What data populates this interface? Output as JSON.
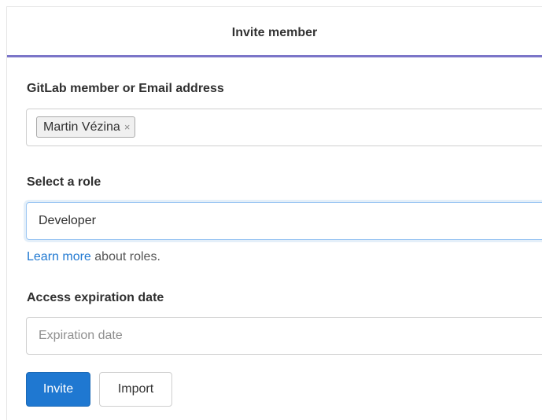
{
  "header": {
    "title": "Invite member"
  },
  "member_field": {
    "label": "GitLab member or Email address",
    "token_value": "Martin Vézina",
    "token_remove_glyph": "×"
  },
  "role_field": {
    "label": "Select a role",
    "value": "Developer",
    "help_link_text": "Learn more",
    "help_suffix": " about roles."
  },
  "expiration_field": {
    "label": "Access expiration date",
    "placeholder": "Expiration date"
  },
  "actions": {
    "invite_label": "Invite",
    "import_label": "Import"
  },
  "colors": {
    "accent": "#1f78d1",
    "tab_underline": "#7b75c8"
  }
}
